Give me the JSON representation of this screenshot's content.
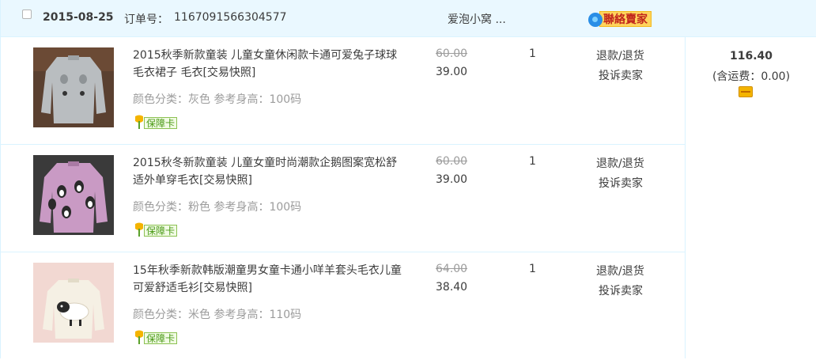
{
  "order": {
    "date": "2015-08-25",
    "number_label": "订单号：",
    "number": "1167091566304577",
    "shop": "爱泡小窝 ...",
    "contact_label": "聯絡賣家",
    "total": "116.40",
    "shipping_note": "(含运费：0.00)"
  },
  "items": [
    {
      "title": "2015秋季新款童装 儿童女童休闲款卡通可爱兔子球球毛衣裙子 毛衣[交易快照]",
      "attrs": "颜色分类：灰色   参考身高：100码",
      "badge": "保障卡",
      "original_price": "60.00",
      "price": "39.00",
      "qty": "1",
      "action_refund": "退款/退货",
      "action_complain": "投诉卖家"
    },
    {
      "title": "2015秋冬新款童装 儿童女童时尚潮款企鹅图案宽松舒适外单穿毛衣[交易快照]",
      "attrs": "颜色分类：粉色   参考身高：100码",
      "badge": "保障卡",
      "original_price": "60.00",
      "price": "39.00",
      "qty": "1",
      "action_refund": "退款/退货",
      "action_complain": "投诉卖家"
    },
    {
      "title": "15年秋季新款韩版潮童男女童卡通小咩羊套头毛衣儿童可爱舒适毛衫[交易快照]",
      "attrs": "颜色分类：米色   参考身高：110码",
      "badge": "保障卡",
      "original_price": "64.00",
      "price": "38.40",
      "qty": "1",
      "action_refund": "退款/退货",
      "action_complain": "投诉卖家"
    }
  ],
  "colors": {
    "header_bg": "#eaf8ff",
    "border": "#daf3ff",
    "text": "#3c3c3c",
    "muted": "#9c9c9c",
    "contact_bg": "#ffd35c",
    "contact_text": "#c1261c"
  },
  "icons": {
    "checkbox": "checkbox",
    "contact": "chat-bubble-icon",
    "badge": "tulip-icon",
    "payment": "card-icon"
  }
}
